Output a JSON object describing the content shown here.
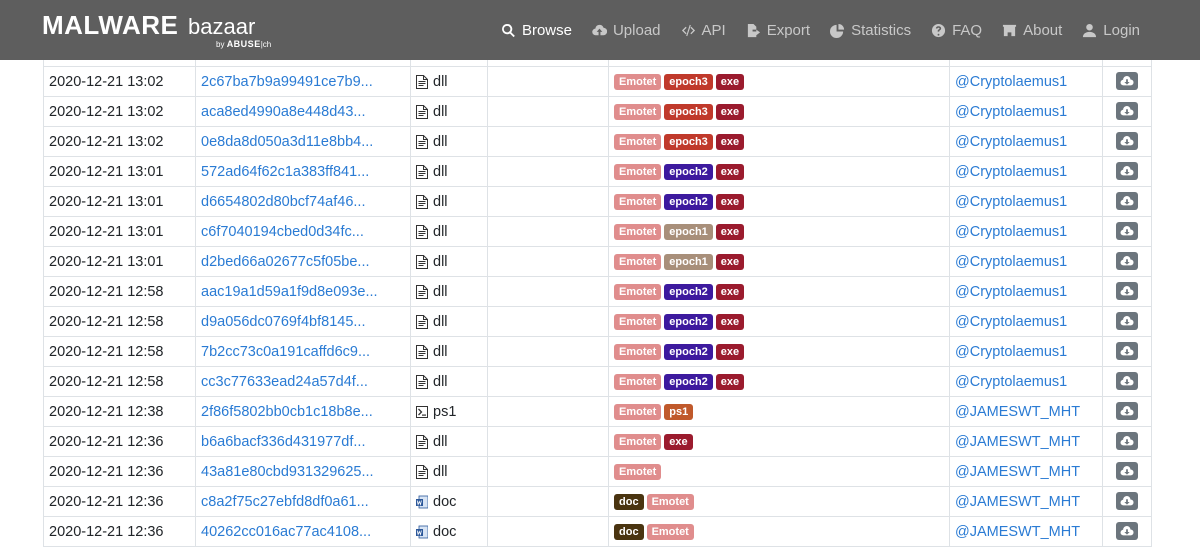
{
  "brand": {
    "main": "MALWARE",
    "sub": "bazaar",
    "by": "by",
    "by_org": "ABUSE",
    "by_suffix": "ch"
  },
  "nav": [
    {
      "label": "Browse",
      "icon": "search-icon",
      "active": true
    },
    {
      "label": "Upload",
      "icon": "cloud-upload-icon",
      "active": false
    },
    {
      "label": "API",
      "icon": "code-icon",
      "active": false
    },
    {
      "label": "Export",
      "icon": "file-export-icon",
      "active": false
    },
    {
      "label": "Statistics",
      "icon": "pie-chart-icon",
      "active": false
    },
    {
      "label": "FAQ",
      "icon": "question-circle-icon",
      "active": false
    },
    {
      "label": "About",
      "icon": "building-icon",
      "active": false
    },
    {
      "label": "Login",
      "icon": "user-icon",
      "active": false
    }
  ],
  "tag_colors": {
    "Emotet": "#e08d8d",
    "epoch3": "#c0392b",
    "epoch2": "#3d1a9e",
    "epoch1": "#a88f7a",
    "exe": "#9b1b2e",
    "ps1": "#c0592b",
    "doc": "#4a3410"
  },
  "rows": [
    {
      "date": "2020-12-21 13:02",
      "hash": "2c67ba7b9a99491ce7b9...",
      "type": "dll",
      "tags": [
        "Emotet",
        "epoch3",
        "exe"
      ],
      "reporter": "@Cryptolaemus1"
    },
    {
      "date": "2020-12-21 13:02",
      "hash": "aca8ed4990a8e448d43...",
      "type": "dll",
      "tags": [
        "Emotet",
        "epoch3",
        "exe"
      ],
      "reporter": "@Cryptolaemus1"
    },
    {
      "date": "2020-12-21 13:02",
      "hash": "0e8da8d050a3d11e8bb4...",
      "type": "dll",
      "tags": [
        "Emotet",
        "epoch3",
        "exe"
      ],
      "reporter": "@Cryptolaemus1"
    },
    {
      "date": "2020-12-21 13:01",
      "hash": "572ad64f62c1a383ff841...",
      "type": "dll",
      "tags": [
        "Emotet",
        "epoch2",
        "exe"
      ],
      "reporter": "@Cryptolaemus1"
    },
    {
      "date": "2020-12-21 13:01",
      "hash": "d6654802d80bcf74af46...",
      "type": "dll",
      "tags": [
        "Emotet",
        "epoch2",
        "exe"
      ],
      "reporter": "@Cryptolaemus1"
    },
    {
      "date": "2020-12-21 13:01",
      "hash": "c6f7040194cbed0d34fc...",
      "type": "dll",
      "tags": [
        "Emotet",
        "epoch1",
        "exe"
      ],
      "reporter": "@Cryptolaemus1"
    },
    {
      "date": "2020-12-21 13:01",
      "hash": "d2bed66a02677c5f05be...",
      "type": "dll",
      "tags": [
        "Emotet",
        "epoch1",
        "exe"
      ],
      "reporter": "@Cryptolaemus1"
    },
    {
      "date": "2020-12-21 12:58",
      "hash": "aac19a1d59a1f9d8e093e...",
      "type": "dll",
      "tags": [
        "Emotet",
        "epoch2",
        "exe"
      ],
      "reporter": "@Cryptolaemus1"
    },
    {
      "date": "2020-12-21 12:58",
      "hash": "d9a056dc0769f4bf8145...",
      "type": "dll",
      "tags": [
        "Emotet",
        "epoch2",
        "exe"
      ],
      "reporter": "@Cryptolaemus1"
    },
    {
      "date": "2020-12-21 12:58",
      "hash": "7b2cc73c0a191caffd6c9...",
      "type": "dll",
      "tags": [
        "Emotet",
        "epoch2",
        "exe"
      ],
      "reporter": "@Cryptolaemus1"
    },
    {
      "date": "2020-12-21 12:58",
      "hash": "cc3c77633ead24a57d4f...",
      "type": "dll",
      "tags": [
        "Emotet",
        "epoch2",
        "exe"
      ],
      "reporter": "@Cryptolaemus1"
    },
    {
      "date": "2020-12-21 12:38",
      "hash": "2f86f5802bb0cb1c18b8e...",
      "type": "ps1",
      "tags": [
        "Emotet",
        "ps1"
      ],
      "reporter": "@JAMESWT_MHT"
    },
    {
      "date": "2020-12-21 12:36",
      "hash": "b6a6bacf336d431977df...",
      "type": "dll",
      "tags": [
        "Emotet",
        "exe"
      ],
      "reporter": "@JAMESWT_MHT"
    },
    {
      "date": "2020-12-21 12:36",
      "hash": "43a81e80cbd931329625...",
      "type": "dll",
      "tags": [
        "Emotet"
      ],
      "reporter": "@JAMESWT_MHT"
    },
    {
      "date": "2020-12-21 12:36",
      "hash": "c8a2f75c27ebfd8df0a61...",
      "type": "doc",
      "tags": [
        "doc",
        "Emotet"
      ],
      "reporter": "@JAMESWT_MHT"
    },
    {
      "date": "2020-12-21 12:36",
      "hash": "40262cc016ac77ac4108...",
      "type": "doc",
      "tags": [
        "doc",
        "Emotet"
      ],
      "reporter": "@JAMESWT_MHT"
    }
  ]
}
